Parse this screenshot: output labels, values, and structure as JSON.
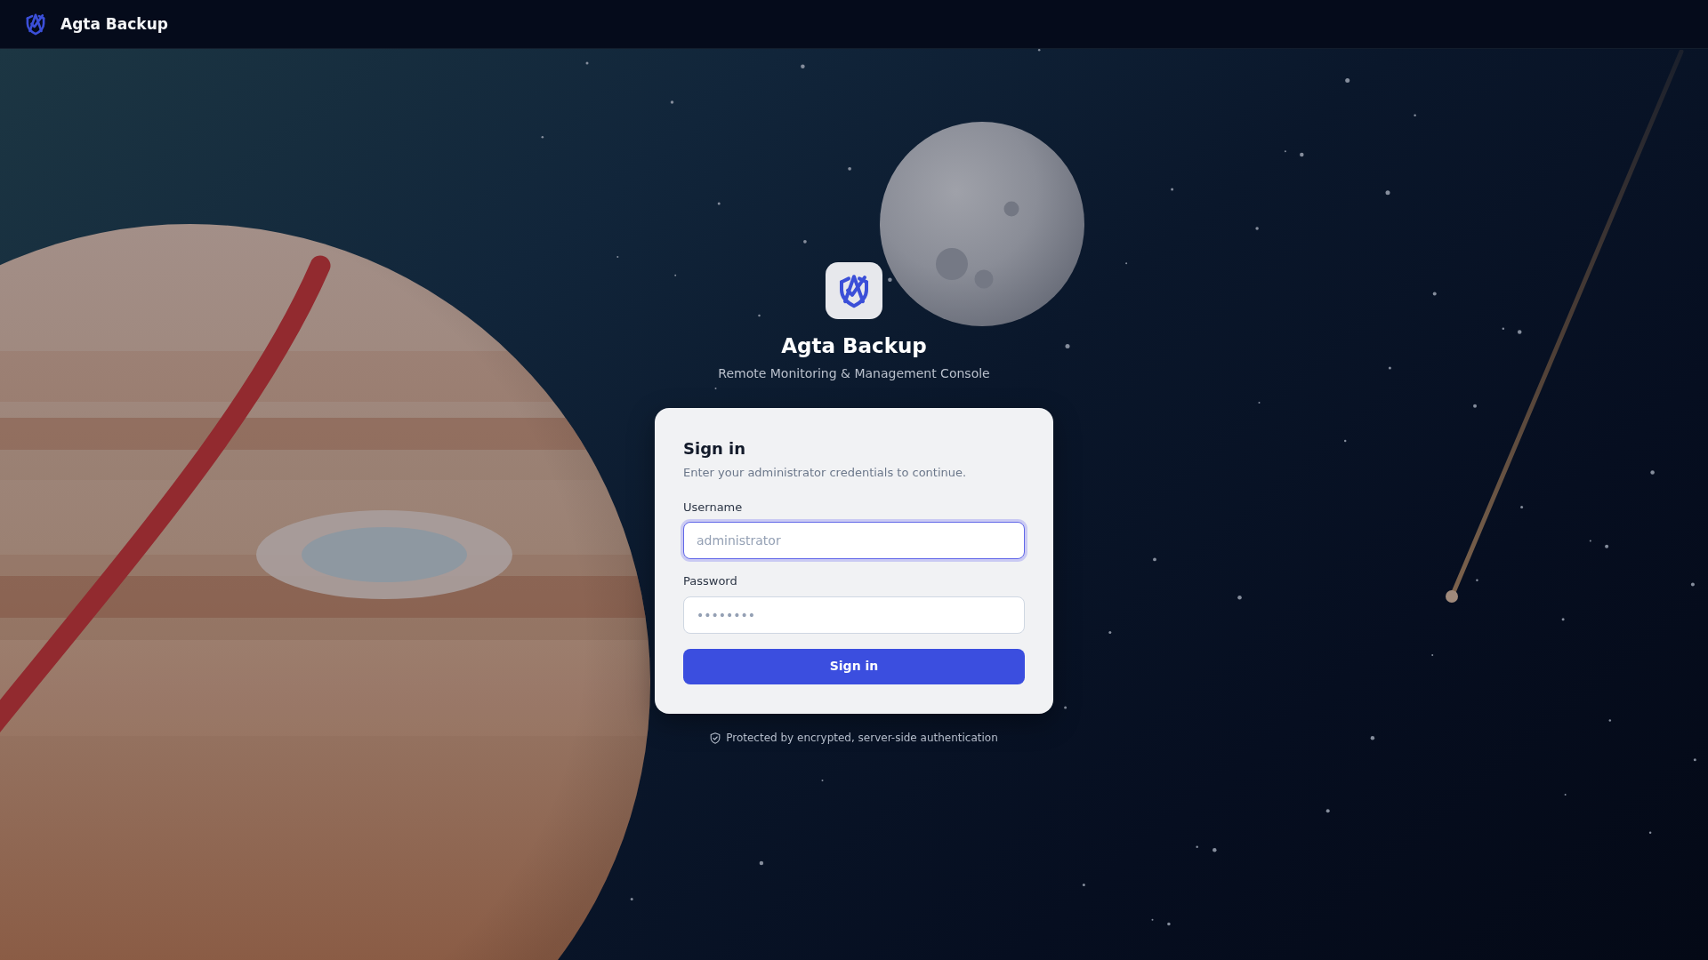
{
  "navbar": {
    "brand": "Agta Backup"
  },
  "header": {
    "title": "Agta Backup",
    "subtitle": "Remote Monitoring & Management Console"
  },
  "sign_in_card": {
    "title": "Sign in",
    "description": "Enter your administrator credentials to continue.",
    "fields": [
      {
        "label": "Username",
        "placeholder": "administrator",
        "focused": true
      },
      {
        "label": "Password",
        "placeholder": "••••••••",
        "focused": false
      }
    ],
    "submit_button": "Sign in"
  },
  "footer_note": "Protected by encrypted, server-side authentication"
}
